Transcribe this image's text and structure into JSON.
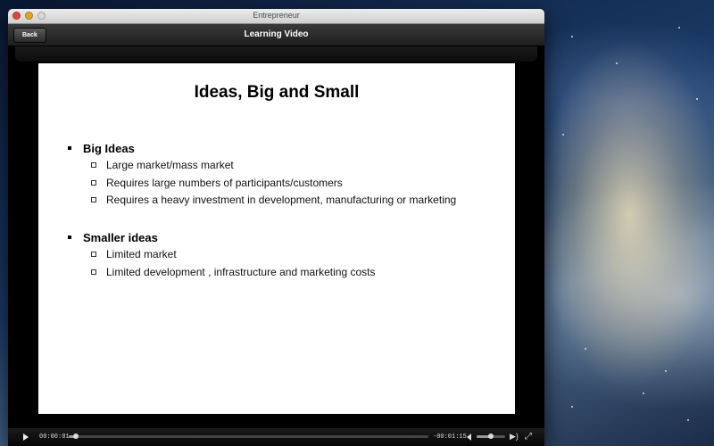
{
  "window": {
    "title": "Entrepreneur"
  },
  "navbar": {
    "back_label": "Back",
    "title": "Learning Video"
  },
  "slide": {
    "title": "Ideas, Big and Small",
    "sections": [
      {
        "heading": "Big Ideas",
        "items": [
          "Large market/mass market",
          "Requires large numbers of participants/customers",
          "Requires a heavy investment in development, manufacturing or marketing"
        ]
      },
      {
        "heading": "Smaller ideas",
        "items": [
          "Limited market",
          "Limited development , infrastructure and marketing costs"
        ]
      }
    ]
  },
  "player": {
    "current_time": "00:00:01",
    "remaining_time": "-00:01:15",
    "progress": 0.02,
    "volume": 0.5
  }
}
